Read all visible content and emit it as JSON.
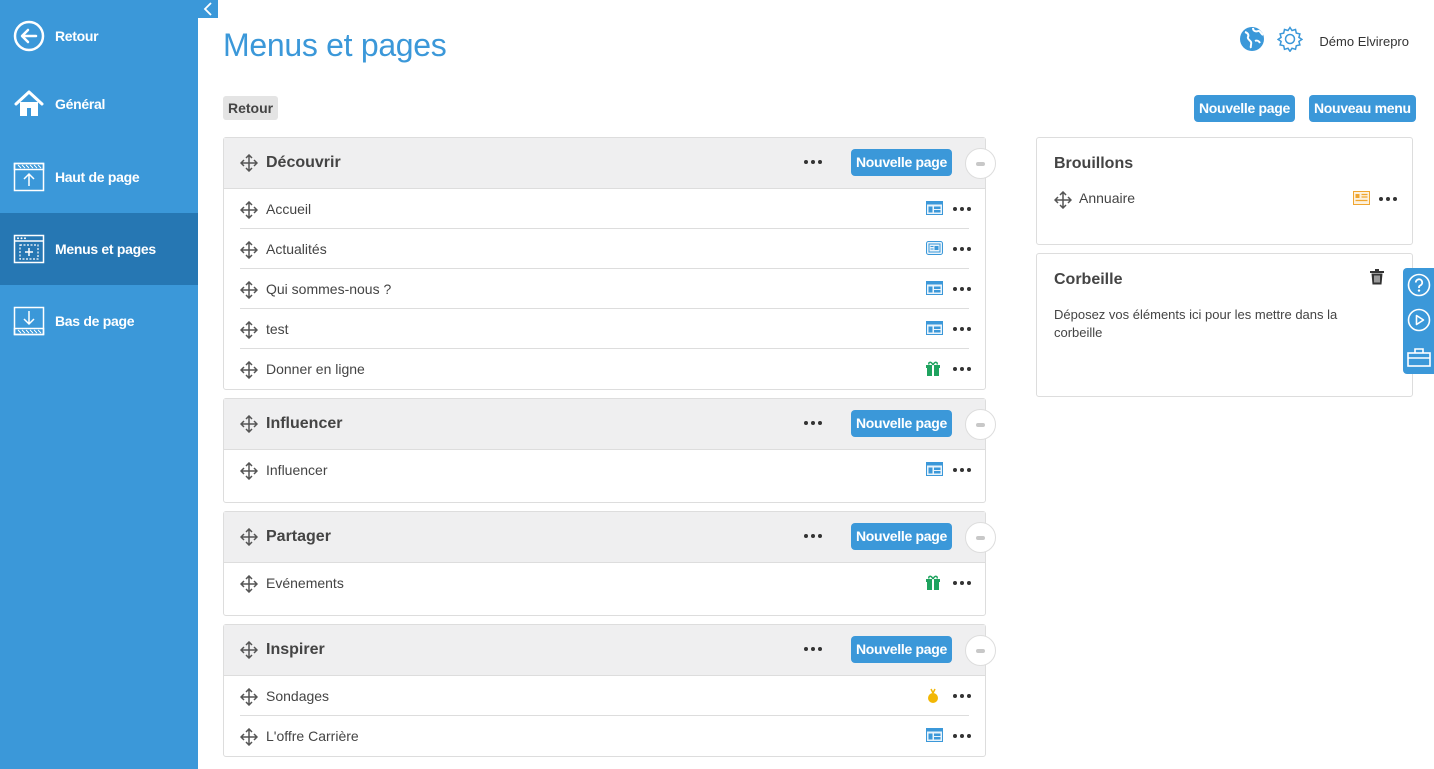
{
  "sidebar": {
    "items": [
      {
        "label": "Retour",
        "icon": "back-arrow-icon"
      },
      {
        "label": "Général",
        "icon": "home-icon"
      },
      {
        "label": "Haut de page",
        "icon": "page-header-icon"
      },
      {
        "label": "Menus et pages",
        "icon": "menus-pages-icon",
        "active": true
      },
      {
        "label": "Bas de page",
        "icon": "page-footer-icon"
      }
    ]
  },
  "header": {
    "title": "Menus et pages",
    "user_name": "Démo Elvirepro",
    "back_label": "Retour",
    "new_page_label": "Nouvelle page",
    "new_menu_label": "Nouveau menu"
  },
  "menus": [
    {
      "title": "Découvrir",
      "new_page_label": "Nouvelle page",
      "pages": [
        {
          "label": "Accueil",
          "type_icon": "layout-page-icon"
        },
        {
          "label": "Actualités",
          "type_icon": "news-page-icon"
        },
        {
          "label": "Qui sommes-nous ?",
          "type_icon": "layout-page-icon"
        },
        {
          "label": "test",
          "type_icon": "layout-page-icon"
        },
        {
          "label": "Donner en ligne",
          "type_icon": "gift-icon"
        }
      ]
    },
    {
      "title": "Influencer",
      "new_page_label": "Nouvelle page",
      "pages": [
        {
          "label": "Influencer",
          "type_icon": "layout-page-icon"
        }
      ]
    },
    {
      "title": "Partager",
      "new_page_label": "Nouvelle page",
      "pages": [
        {
          "label": "Evénements",
          "type_icon": "gift-icon"
        }
      ]
    },
    {
      "title": "Inspirer",
      "new_page_label": "Nouvelle page",
      "pages": [
        {
          "label": "Sondages",
          "type_icon": "poll-icon"
        },
        {
          "label": "L'offre Carrière",
          "type_icon": "layout-page-icon"
        }
      ]
    }
  ],
  "drafts": {
    "title": "Brouillons",
    "items": [
      {
        "label": "Annuaire",
        "type_icon": "directory-card-icon"
      }
    ]
  },
  "trash": {
    "title": "Corbeille",
    "text": "Déposez vos éléments ici pour les mettre dans la corbeille"
  },
  "colors": {
    "sidebar": "#3b98d9",
    "sidebar_active": "#2677b3",
    "accent": "#3b98d9",
    "gift": "#1fa35f",
    "poll": "#f2b705",
    "directory": "#f0a630"
  }
}
